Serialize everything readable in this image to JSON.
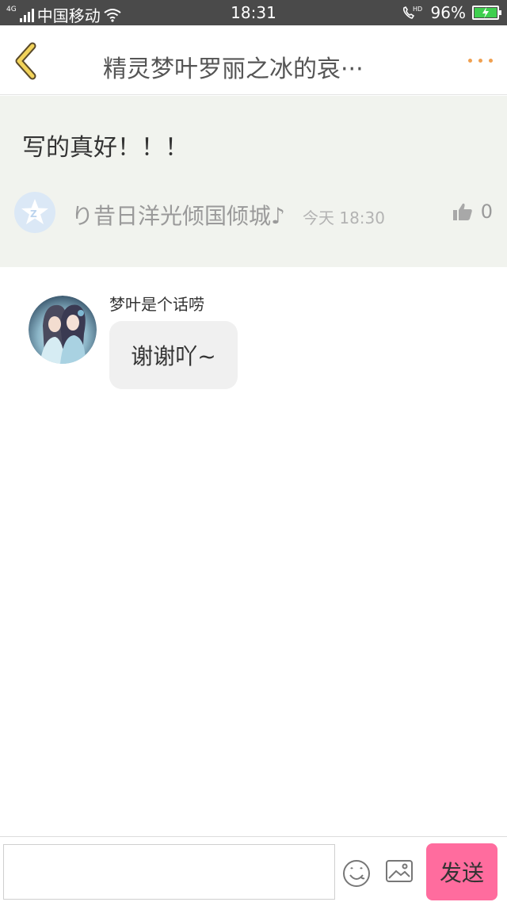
{
  "status_bar": {
    "network": "4G",
    "carrier": "中国移动",
    "time": "18:31",
    "call_tag": "HD",
    "battery": "96%",
    "battery_level": 0.96
  },
  "header": {
    "title": "精灵梦叶罗丽之冰的哀···",
    "back_icon": "chevron-left-icon",
    "more_icon": "ellipsis-icon",
    "accent_color": "#f0a050"
  },
  "original_comment": {
    "text": "写的真好！！！",
    "user": "り昔日洋光倾国倾城♪",
    "time": "今天 18:30",
    "likes": "0",
    "avatar_icon": "qq-zone-icon"
  },
  "reply": {
    "name": "梦叶是个话唠",
    "message": "谢谢吖~"
  },
  "input_bar": {
    "placeholder": "",
    "send_label": "发送",
    "send_color": "#ff6c9e"
  }
}
